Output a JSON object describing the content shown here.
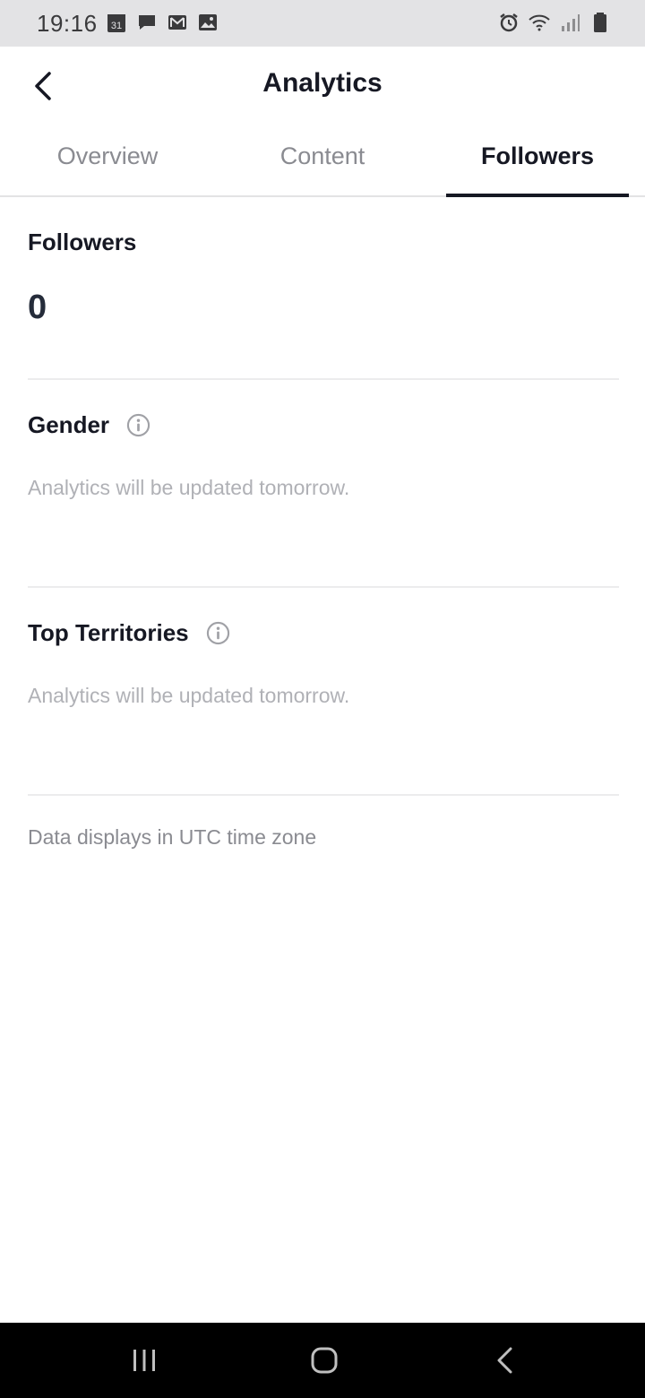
{
  "status_bar": {
    "time": "19:16",
    "calendar_day": "31",
    "left_icons": [
      "calendar-icon",
      "message-icon",
      "gmail-icon",
      "image-icon"
    ],
    "right_icons": [
      "alarm-icon",
      "wifi-icon",
      "signal-icon",
      "battery-icon"
    ]
  },
  "header": {
    "title": "Analytics",
    "back_icon": "chevron-left-icon"
  },
  "tabs": [
    {
      "label": "Overview",
      "active": false
    },
    {
      "label": "Content",
      "active": false
    },
    {
      "label": "Followers",
      "active": true
    }
  ],
  "followers": {
    "title": "Followers",
    "count": "0"
  },
  "gender": {
    "title": "Gender",
    "message": "Analytics will be updated tomorrow."
  },
  "top_territories": {
    "title": "Top Territories",
    "message": "Analytics will be updated tomorrow."
  },
  "footnote": "Data displays in UTC time zone",
  "nav_bar": {
    "icons": [
      "recent-apps-icon",
      "home-icon",
      "back-icon"
    ]
  },
  "colors": {
    "text_primary": "#161823",
    "text_secondary": "#8a8b91",
    "text_muted": "#b0b1b6",
    "status_bar_bg": "#e3e3e5",
    "nav_bar_bg": "#000000"
  }
}
